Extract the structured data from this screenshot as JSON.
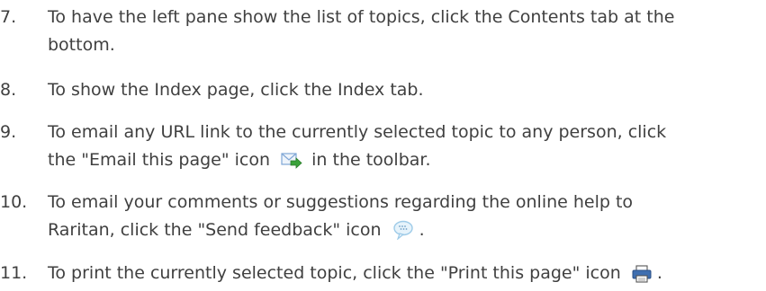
{
  "steps": [
    {
      "number": "7.",
      "line1": "To have the left pane show the list of topics, click the Contents tab at the",
      "line2": "bottom."
    },
    {
      "number": "8.",
      "line1": "To show the Index page, click the Index tab."
    },
    {
      "number": "9.",
      "line1": "To email any URL link to the currently selected topic to any person, click",
      "line2_before": "the \"Email this page\" icon",
      "line2_after": "in the toolbar.",
      "icon": "email-page-icon"
    },
    {
      "number": "10.",
      "line1": "To email your comments or suggestions regarding the online help to",
      "line2_before": "Raritan, click the \"Send feedback\" icon",
      "line2_after": ".",
      "icon": "feedback-speech-bubble-icon"
    },
    {
      "number": "11.",
      "line1_before": "To print the currently selected topic, click the \"Print this page\" icon",
      "line1_after": ".",
      "icon": "printer-icon"
    }
  ],
  "colors": {
    "text": "#404040",
    "email_icon_green": "#3aa23a",
    "email_icon_envelope": "#7fa6d6",
    "feedback_bubble": "#9ecbe8",
    "printer_blue": "#3f6fb0"
  }
}
